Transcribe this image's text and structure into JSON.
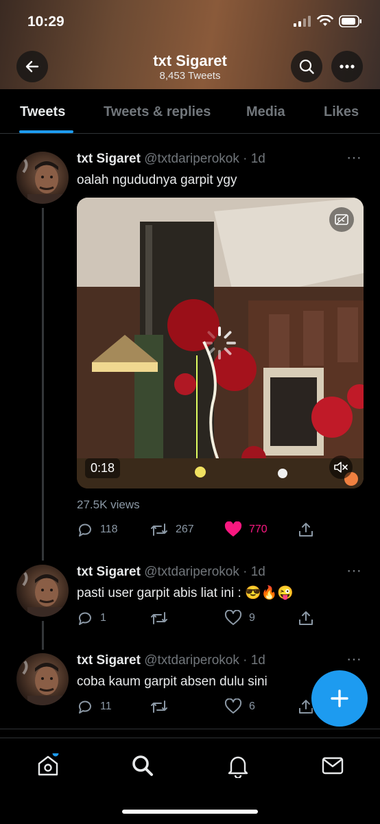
{
  "status_bar": {
    "time": "10:29"
  },
  "header": {
    "title": "txt Sigaret",
    "subtitle": "8,453 Tweets"
  },
  "tabs": [
    {
      "label": "Tweets",
      "active": true
    },
    {
      "label": "Tweets & replies",
      "active": false
    },
    {
      "label": "Media",
      "active": false
    },
    {
      "label": "Likes",
      "active": false
    }
  ],
  "tweets": [
    {
      "name": "txt Sigaret",
      "handle": "@txtdariperokok",
      "time": "· 1d",
      "text": "oalah ngududnya garpit ygy",
      "media": {
        "duration": "0:18",
        "cc_icon": "captions-icon",
        "mute_icon": "mute-icon"
      },
      "views": "27.5K views",
      "replies": "118",
      "retweets": "267",
      "likes": "770",
      "liked": true
    },
    {
      "name": "txt Sigaret",
      "handle": "@txtdariperokok",
      "time": "· 1d",
      "text": "pasti user garpit abis liat ini : 😎🔥😜",
      "replies": "1",
      "retweets": "",
      "likes": "9"
    },
    {
      "name": "txt Sigaret",
      "handle": "@txtdariperokok",
      "time": "· 1d",
      "text": "coba kaum garpit absen dulu sini",
      "replies": "11",
      "retweets": "",
      "likes": "6"
    }
  ],
  "colors": {
    "accent": "#1d9bf0",
    "like": "#f91880",
    "muted": "#71767b"
  }
}
